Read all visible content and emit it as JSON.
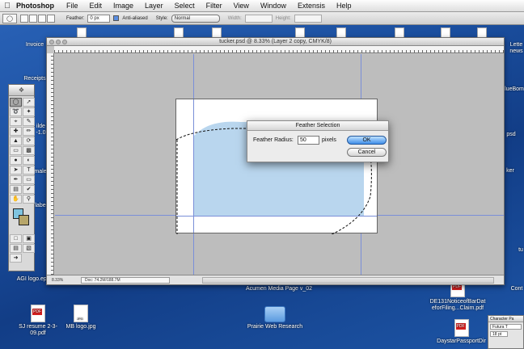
{
  "menubar": {
    "app_name": "Photoshop",
    "items": [
      "File",
      "Edit",
      "Image",
      "Layer",
      "Select",
      "Filter",
      "View",
      "Window",
      "Extensis",
      "Help"
    ]
  },
  "options_bar": {
    "feather_label": "Feather:",
    "feather_value": "0 px",
    "antialiased_label": "Anti-aliased",
    "style_label": "Style:",
    "style_value": "Normal",
    "width_label": "Width:",
    "height_label": "Height:"
  },
  "document": {
    "title": "tucker.psd @ 8.33% (Layer 2 copy, CMYK/8)",
    "zoom": "8.33%",
    "doc_size": "Doc: 74.2M/188.7M",
    "fill_color": "#b9d6ee"
  },
  "dialog": {
    "title": "Feather Selection",
    "radius_label": "Feather Radius:",
    "radius_value": "50",
    "unit": "pixels",
    "ok_label": "OK",
    "cancel_label": "Cancel"
  },
  "desktop": {
    "icons": [
      {
        "label": "Invoice"
      },
      {
        "label": "Receipts"
      },
      {
        "label": "AGI logo.eps"
      },
      {
        "label": "SJ resume 2-3-09.pdf"
      },
      {
        "label": "MB logo.jpg"
      },
      {
        "label": "Acumen Media Page v_02"
      },
      {
        "label": "Prairie Web Research"
      },
      {
        "label": "DE131NoticeofBarDat eforFiling...Claim.pdf"
      },
      {
        "label": "DaystarPassportDir"
      }
    ],
    "partial_labels": {
      "right_1": "Lette",
      "right_2": "news",
      "right_3": "lueBom",
      "right_4": "psd",
      "right_5": "ker",
      "right_6": "tu",
      "right_7": "Cont",
      "left_1": "ilde",
      "left_2": "-1.0",
      "left_3": "male",
      "left_4": "labe"
    }
  },
  "character_panel": {
    "tab1": "Character",
    "tab2": "Pa",
    "font": "Futura T",
    "size": "18 pt"
  },
  "colors": {
    "desktop_blue": "#1b4f9f",
    "ok_button": "#3f8ee8",
    "guide": "#7a8fd8"
  }
}
